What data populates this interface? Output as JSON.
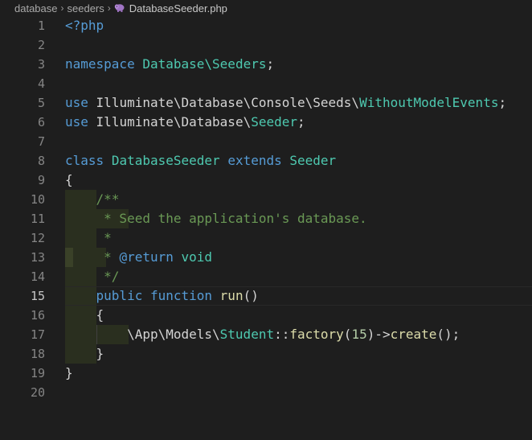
{
  "breadcrumb": {
    "items": [
      "database",
      "seeders"
    ],
    "file": "DatabaseSeeder.php",
    "file_icon": "php-elephant-icon"
  },
  "editor": {
    "active_line": 15,
    "lines": [
      {
        "n": "1",
        "code": "<?php"
      },
      {
        "n": "2",
        "code": ""
      },
      {
        "n": "3",
        "code": "namespace Database\\Seeders;"
      },
      {
        "n": "4",
        "code": ""
      },
      {
        "n": "5",
        "code": "use Illuminate\\Database\\Console\\Seeds\\WithoutModelEvents;"
      },
      {
        "n": "6",
        "code": "use Illuminate\\Database\\Seeder;"
      },
      {
        "n": "7",
        "code": ""
      },
      {
        "n": "8",
        "code": "class DatabaseSeeder extends Seeder"
      },
      {
        "n": "9",
        "code": "{"
      },
      {
        "n": "10",
        "code": "    /**"
      },
      {
        "n": "11",
        "code": "     * Seed the application's database."
      },
      {
        "n": "12",
        "code": "     *"
      },
      {
        "n": "13",
        "code": "     * @return void"
      },
      {
        "n": "14",
        "code": "     */"
      },
      {
        "n": "15",
        "code": "    public function run()"
      },
      {
        "n": "16",
        "code": "    {"
      },
      {
        "n": "17",
        "code": "        \\App\\Models\\Student::factory(15)->create();"
      },
      {
        "n": "18",
        "code": "    }"
      },
      {
        "n": "19",
        "code": "}"
      },
      {
        "n": "20",
        "code": ""
      }
    ]
  },
  "colors": {
    "background": "#1e1e1e",
    "keyword": "#569cd6",
    "type": "#4ec9b0",
    "function": "#dcdcaa",
    "comment": "#6a9955",
    "number": "#b5cea8",
    "text": "#d4d4d4",
    "line_number": "#858585"
  }
}
